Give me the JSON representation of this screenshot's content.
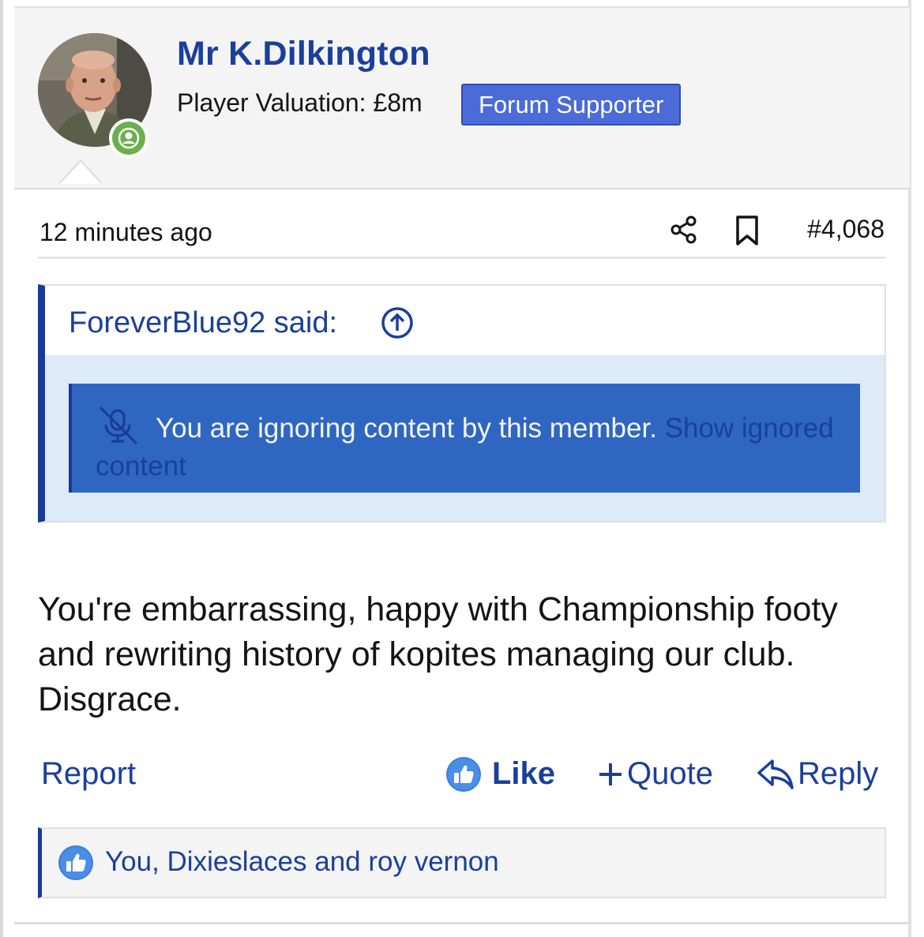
{
  "user": {
    "name": "Mr K.Dilkington",
    "valuation": "Player Valuation: £8m",
    "badge": "Forum Supporter",
    "online_status_icon": "user-online-icon"
  },
  "post": {
    "time": "12 minutes ago",
    "number": "#4,068",
    "share_icon": "share-icon",
    "bookmark_icon": "bookmark-icon",
    "body": "You're embarrassing, happy with Championship footy and rewriting history of kopites managing our club. Disgrace."
  },
  "quote": {
    "author": "ForeverBlue92 said:",
    "jump_icon": "arrow-up-circle-icon",
    "ignored_message": "You are ignoring content by this member.",
    "show_link": "Show ignored content"
  },
  "actions": {
    "report": "Report",
    "like": "Like",
    "quote": "Quote",
    "reply": "Reply"
  },
  "reactions": {
    "text": "You, Dixieslaces and roy vernon"
  },
  "colors": {
    "link": "#1a3f9c",
    "badge_bg": "#4a6bd8",
    "notice_bg": "#2f66c2",
    "online": "#6ab04c"
  }
}
